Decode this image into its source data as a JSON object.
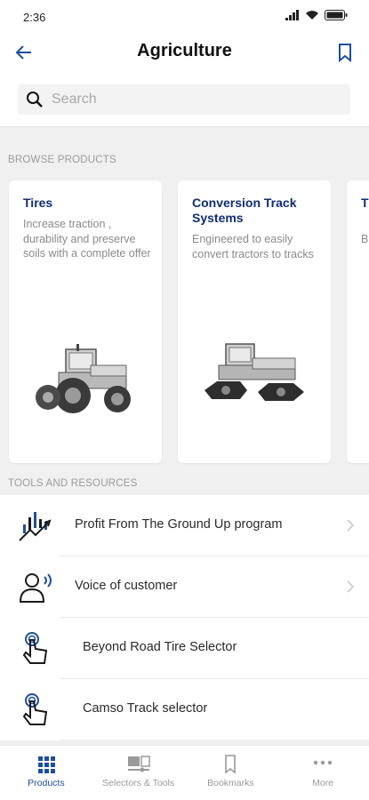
{
  "status": {
    "time": "2:36"
  },
  "header": {
    "title": "Agriculture"
  },
  "search": {
    "placeholder": "Search",
    "value": ""
  },
  "sections": {
    "browse": "BROWSE PRODUCTS",
    "tools": "TOOLS AND RESOURCES"
  },
  "products": [
    {
      "title": "Tires",
      "description": "Increase traction , durability and preserve soils with a complete offer"
    },
    {
      "title": "Conversion Track Systems",
      "description": "Engineered to easily convert tractors to tracks"
    },
    {
      "title_partial": "T S",
      "description_partial": "B re"
    }
  ],
  "tools": [
    {
      "label": "Profit From The Ground Up program",
      "icon": "growth-chart-icon"
    },
    {
      "label": "Voice of customer",
      "icon": "person-speaking-icon"
    },
    {
      "label": "Beyond Road Tire Selector",
      "icon": "touch-hand-icon"
    },
    {
      "label": "Camso Track selector",
      "icon": "touch-hand-icon"
    }
  ],
  "nav": [
    {
      "label": "Products",
      "icon": "grid-icon"
    },
    {
      "label": "Selectors & Tools",
      "icon": "tools-icon"
    },
    {
      "label": "Bookmarks",
      "icon": "bookmark-icon"
    },
    {
      "label": "More",
      "icon": "more-icon"
    }
  ],
  "colors": {
    "accent": "#1d4e9e",
    "card_title": "#0f2d73",
    "background": "#f0f0f0"
  }
}
